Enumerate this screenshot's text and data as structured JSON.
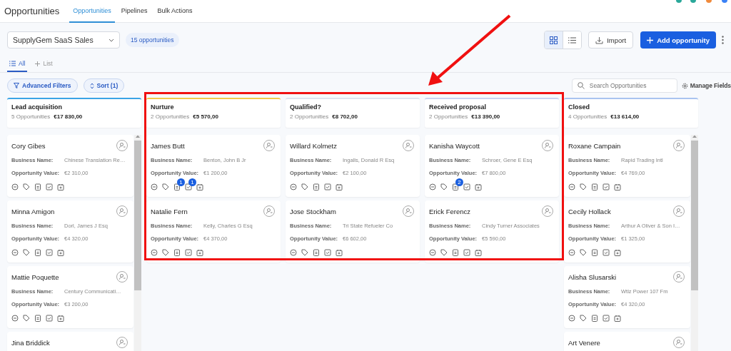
{
  "header": {
    "title": "Opportunities",
    "tabs": [
      {
        "label": "Opportunities",
        "selected": true
      },
      {
        "label": "Pipelines",
        "selected": false
      },
      {
        "label": "Bulk Actions",
        "selected": false
      }
    ]
  },
  "toolbar": {
    "pipeline": "SupplyGem SaaS Sales",
    "count_badge": "15 opportunities",
    "view_toggle": [
      {
        "kind": "grid",
        "selected": true
      },
      {
        "kind": "list",
        "selected": false
      }
    ],
    "import_button": "Import",
    "add_button": "Add opportunity"
  },
  "list_tabs": [
    {
      "kind": "list",
      "label": "All",
      "selected": true
    },
    {
      "kind": "add",
      "label": "List",
      "selected": false
    }
  ],
  "filters": {
    "advanced_filters": "Advanced Filters",
    "sort": "Sort (1)",
    "search": {
      "placeholder": "Search Opportunities"
    },
    "manage_fields": "Manage Fields"
  },
  "columns": [
    {
      "title": "Lead acquisition",
      "count": "5 Opportunities",
      "total": "€17 830,00",
      "color": "#3ba4e6",
      "cards": [
        {
          "name": "Cory Gibes",
          "business_label": "Business Name:",
          "business": "Chinese Translation Re…",
          "value_label": "Opportunity Value:",
          "value": "€2 310,00"
        },
        {
          "name": "Minna Amigon",
          "business_label": "Business Name:",
          "business": "Dorl, James J Esq",
          "value_label": "Opportunity Value:",
          "value": "€4 320,00"
        },
        {
          "name": "Mattie Poquette",
          "business_label": "Business Name:",
          "business": "Century Communicati…",
          "value_label": "Opportunity Value:",
          "value": "€3 200,00"
        },
        {
          "name": "Jina Briddick"
        }
      ]
    },
    {
      "title": "Nurture",
      "count": "2 Opportunities",
      "total": "€5 570,00",
      "color": "#f2c94c",
      "cards": [
        {
          "name": "James Butt",
          "business_label": "Business Name:",
          "business": "Benton, John B Jr",
          "value_label": "Opportunity Value:",
          "value": "€1 200,00",
          "note_count": "1",
          "task_count": "1"
        },
        {
          "name": "Natalie Fern",
          "business_label": "Business Name:",
          "business": "Kelly, Charles G Esq",
          "value_label": "Opportunity Value:",
          "value": "€4 370,00"
        }
      ]
    },
    {
      "title": "Qualified?",
      "count": "2 Opportunities",
      "total": "€8 702,00",
      "color": "#dde3ee",
      "cards": [
        {
          "name": "Willard Kolmetz",
          "business_label": "Business Name:",
          "business": "Ingalls, Donald R Esq",
          "value_label": "Opportunity Value:",
          "value": "€2 100,00"
        },
        {
          "name": "Jose Stockham",
          "business_label": "Business Name:",
          "business": "Tri State Refueler Co",
          "value_label": "Opportunity Value:",
          "value": "€6 602,00"
        }
      ]
    },
    {
      "title": "Received proposal",
      "count": "2 Opportunities",
      "total": "€13 390,00",
      "color": "#c9d3f0",
      "cards": [
        {
          "name": "Kanisha Waycott",
          "business_label": "Business Name:",
          "business": "Schroer, Gene E Esq",
          "value_label": "Opportunity Value:",
          "value": "€7 800,00",
          "note_count": "2"
        },
        {
          "name": "Erick Ferencz",
          "business_label": "Business Name:",
          "business": "Cindy Turner Associates",
          "value_label": "Opportunity Value:",
          "value": "€5 590,00"
        }
      ]
    },
    {
      "title": "Closed",
      "count": "4 Opportunities",
      "total": "€13 614,00",
      "color": "#a9c4f0",
      "cards": [
        {
          "name": "Roxane Campain",
          "business_label": "Business Name:",
          "business": "Rapid Trading Intl",
          "value_label": "Opportunity Value:",
          "value": "€4 769,00"
        },
        {
          "name": "Cecily Hollack",
          "business_label": "Business Name:",
          "business": "Arthur A Oliver & Son I…",
          "value_label": "Opportunity Value:",
          "value": "€1 325,00"
        },
        {
          "name": "Alisha Slusarski",
          "business_label": "Business Name:",
          "business": "Wtlz Power 107 Fm",
          "value_label": "Opportunity Value:",
          "value": "€4 320,00"
        },
        {
          "name": "Art Venere"
        }
      ]
    }
  ]
}
